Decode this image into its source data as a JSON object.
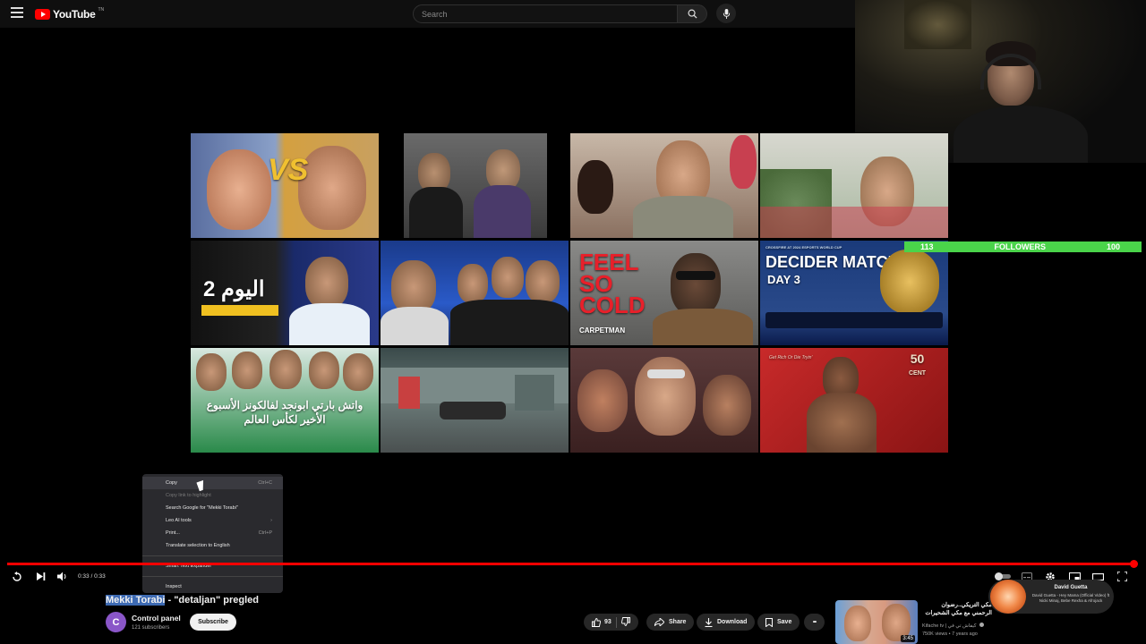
{
  "app": {
    "name": "YouTube",
    "country_code": "TN"
  },
  "search": {
    "placeholder": "Search"
  },
  "followers_overlay": {
    "left_count": "113",
    "label": "FOLLOWERS",
    "right_count": "100"
  },
  "end_screen": {
    "videos": [
      {
        "caption": "VS"
      },
      {
        "caption": ""
      },
      {
        "caption": "اليوم 2"
      },
      {
        "caption": ""
      },
      {
        "caption": "اليوم 2"
      },
      {
        "caption": ""
      },
      {
        "caption": "FEEL SO COLD",
        "sub": "CARPETMAN"
      },
      {
        "caption": "DECIDER MATCH",
        "sub": "DAY 3",
        "top": "CROSSFIRE AT 2024 ESPORTS WORLD CUP"
      },
      {
        "caption": "واتش بارتي ابونجد لفالكونز الأسبوع الأخير لكأس العالم"
      },
      {
        "caption": ""
      },
      {
        "caption": ""
      },
      {
        "caption": "50 CENT",
        "sub": "Get Rich Or Die Tryin'"
      }
    ]
  },
  "context_menu": {
    "items": [
      {
        "label": "Copy",
        "shortcut": "Ctrl+C",
        "enabled": true
      },
      {
        "label": "Copy link to highlight",
        "shortcut": "",
        "enabled": false
      },
      {
        "label": "Search Google for \"Mekki Torabi\"",
        "shortcut": "",
        "enabled": true
      },
      {
        "label": "Leo AI tools",
        "shortcut": "›",
        "enabled": true
      },
      {
        "label": "Print...",
        "shortcut": "Ctrl+P",
        "enabled": true
      },
      {
        "label": "Translate selection to English",
        "shortcut": "",
        "enabled": true
      },
      {
        "label": "Smart Text Expander",
        "shortcut": "",
        "enabled": true
      },
      {
        "label": "Inspect",
        "shortcut": "",
        "enabled": true
      }
    ]
  },
  "player": {
    "time": "0:33 / 0:33",
    "progress": 1.0
  },
  "video": {
    "title_selected": "Mekki Torabi",
    "title_rest": " - \"detaljan\" pregled",
    "channel_initial": "C",
    "channel_name": "Control panel",
    "subscribers": "121 subscribers",
    "subscribe_label": "Subscribe",
    "likes": "93",
    "share_label": "Share",
    "download_label": "Download",
    "save_label": "Save",
    "more_label": "•••"
  },
  "sidebar_video": {
    "title": "مكي التريكي..رضوان الرحمني مع مكي الشحيرات",
    "duration": "3:45",
    "channel": "Kifache tv | كيفاش تي في",
    "meta": "750K views • 7 years ago"
  },
  "now_playing": {
    "artist": "David Guetta",
    "track": "David Guetta - Hey Mama (Official Video) ft Nicki Minaj, Bebe Rexha & Afrojack"
  },
  "colors": {
    "accent": "#ff0000",
    "followers_bar": "#4ad44a",
    "selection": "#3d6ab3"
  }
}
